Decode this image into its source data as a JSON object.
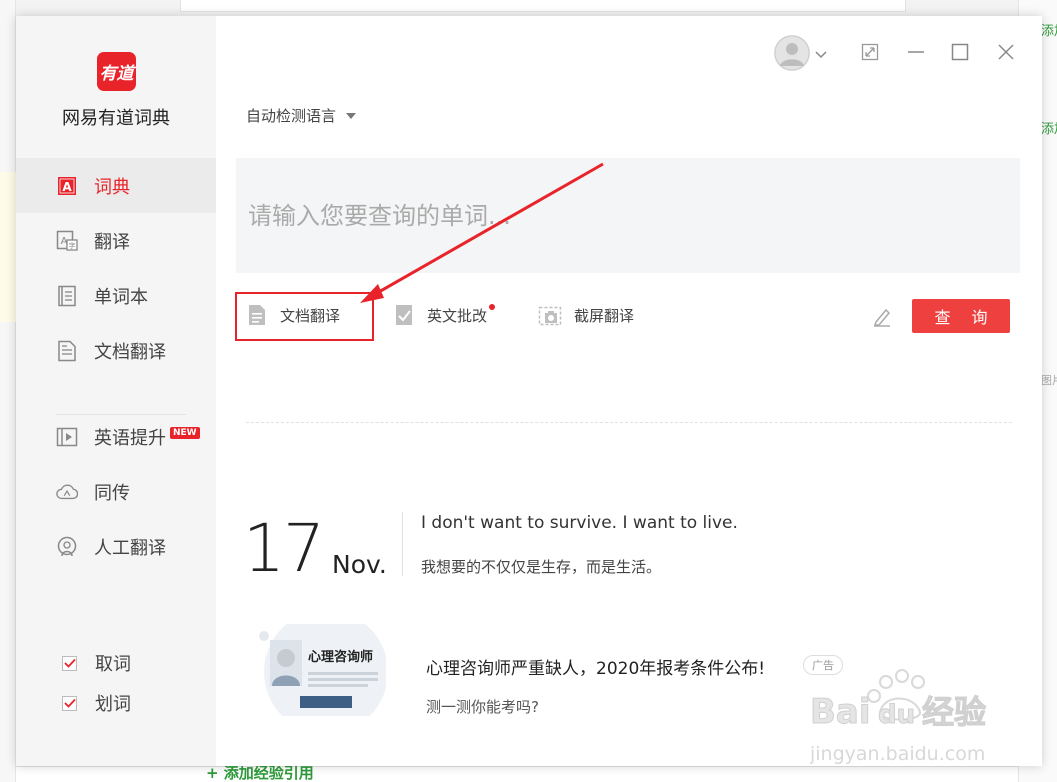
{
  "background": {
    "right_link_1": "添加",
    "right_link_2": "添加",
    "right_gray": "图片",
    "bottom_link": "+ 添加经验引用"
  },
  "app": {
    "logo_text": "有道",
    "name": "网易有道词典"
  },
  "sidebar": {
    "items": [
      {
        "label": "词典",
        "icon": "dictionary-icon",
        "active": true
      },
      {
        "label": "翻译",
        "icon": "translate-icon",
        "active": false
      },
      {
        "label": "单词本",
        "icon": "wordbook-icon",
        "active": false
      },
      {
        "label": "文档翻译",
        "icon": "document-icon",
        "active": false
      },
      {
        "label": "英语提升",
        "icon": "video-play-icon",
        "active": false,
        "badge": "NEW"
      },
      {
        "label": "同传",
        "icon": "interpret-icon",
        "active": false
      },
      {
        "label": "人工翻译",
        "icon": "human-translate-icon",
        "active": false
      }
    ],
    "checks": [
      {
        "label": "取词",
        "checked": true
      },
      {
        "label": "划词",
        "checked": true
      }
    ]
  },
  "main": {
    "language_select": "自动检测语言",
    "search": {
      "placeholder": "请输入您要查询的单词...",
      "value": ""
    },
    "tools": [
      {
        "label": "文档翻译",
        "icon": "document-translate-icon"
      },
      {
        "label": "英文批改",
        "icon": "correction-icon",
        "dot": true
      },
      {
        "label": "截屏翻译",
        "icon": "screenshot-icon"
      }
    ],
    "query_button": "查 询",
    "daily": {
      "day": "17",
      "month": "Nov.",
      "quote_en": "I don't want to survive. I want to live.",
      "quote_cn": "我想要的不仅仅是生存，而是生活。"
    },
    "ad": {
      "thumb_title": "心理咨询师",
      "title": "心理咨询师严重缺人，2020年报考条件公布!",
      "badge": "广告",
      "subtitle": "测一测你能考吗?"
    }
  },
  "watermark": {
    "brand": "Bai du 经验",
    "url": "jingyan.baidu.com"
  },
  "colors": {
    "accent": "#e8232a",
    "button": "#ef4040",
    "sidebar_bg": "#f5f5f5"
  }
}
